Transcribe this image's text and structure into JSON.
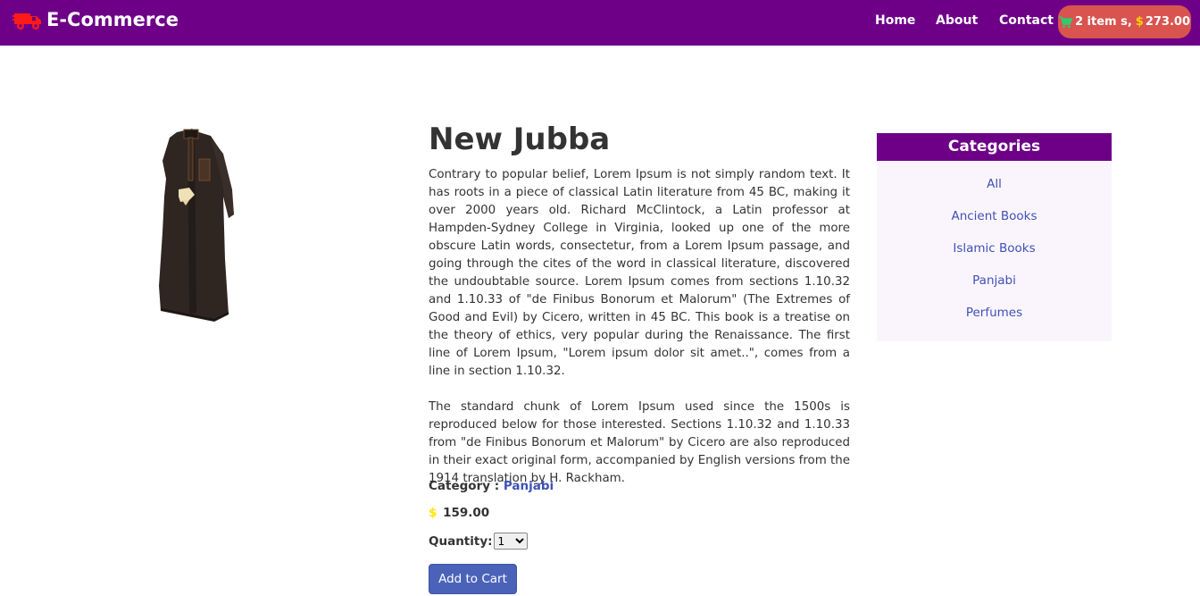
{
  "navbar": {
    "brand": "E-Commerce",
    "links": [
      "Home",
      "About",
      "Contact"
    ],
    "cart": {
      "count_text": "2 item s,",
      "currency": "$",
      "total": "273.00"
    }
  },
  "product": {
    "title": "New Jubba",
    "description": [
      "Contrary to popular belief, Lorem Ipsum is not simply random text. It has roots in a piece of classical Latin literature from 45 BC, making it over 2000 years old. Richard McClintock, a Latin professor at Hampden-Sydney College in Virginia, looked up one of the more obscure Latin words, consectetur, from a Lorem Ipsum passage, and going through the cites of the word in classical literature, discovered the undoubtable source. Lorem Ipsum comes from sections 1.10.32 and 1.10.33 of \"de Finibus Bonorum et Malorum\" (The Extremes of Good and Evil) by Cicero, written in 45 BC. This book is a treatise on the theory of ethics, very popular during the Renaissance. The first line of Lorem Ipsum, \"Lorem ipsum dolor sit amet..\", comes from a line in section 1.10.32.",
      "The standard chunk of Lorem Ipsum used since the 1500s is reproduced below for those interested. Sections 1.10.32 and 1.10.33 from \"de Finibus Bonorum et Malorum\" by Cicero are also reproduced in their exact original form, accompanied by English versions from the 1914 translation by H. Rackham."
    ],
    "category_label": "Category :",
    "category": "Panjabi",
    "currency": "$",
    "price": "159.00",
    "quantity_label": "Quantity:",
    "quantity_value": "1",
    "add_to_cart_label": "Add to Cart"
  },
  "categories": {
    "title": "Categories",
    "items": [
      "All",
      "Ancient Books",
      "Islamic Books",
      "Panjabi",
      "Perfumes"
    ]
  },
  "colors": {
    "navbar": "#6d0087",
    "cart_pill": "#d9534f",
    "link": "#3f51b5",
    "button": "#4a63b9",
    "dollar_sign": "#ffe600"
  },
  "icons": {
    "brand": "truck-icon",
    "cart": "shopping-cart-icon"
  }
}
